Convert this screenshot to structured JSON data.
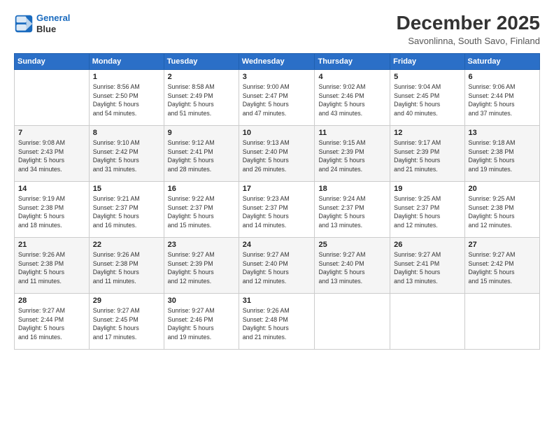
{
  "logo": {
    "line1": "General",
    "line2": "Blue"
  },
  "title": "December 2025",
  "subtitle": "Savonlinna, South Savo, Finland",
  "days_of_week": [
    "Sunday",
    "Monday",
    "Tuesday",
    "Wednesday",
    "Thursday",
    "Friday",
    "Saturday"
  ],
  "weeks": [
    [
      {
        "day": "",
        "info": ""
      },
      {
        "day": "1",
        "info": "Sunrise: 8:56 AM\nSunset: 2:50 PM\nDaylight: 5 hours\nand 54 minutes."
      },
      {
        "day": "2",
        "info": "Sunrise: 8:58 AM\nSunset: 2:49 PM\nDaylight: 5 hours\nand 51 minutes."
      },
      {
        "day": "3",
        "info": "Sunrise: 9:00 AM\nSunset: 2:47 PM\nDaylight: 5 hours\nand 47 minutes."
      },
      {
        "day": "4",
        "info": "Sunrise: 9:02 AM\nSunset: 2:46 PM\nDaylight: 5 hours\nand 43 minutes."
      },
      {
        "day": "5",
        "info": "Sunrise: 9:04 AM\nSunset: 2:45 PM\nDaylight: 5 hours\nand 40 minutes."
      },
      {
        "day": "6",
        "info": "Sunrise: 9:06 AM\nSunset: 2:44 PM\nDaylight: 5 hours\nand 37 minutes."
      }
    ],
    [
      {
        "day": "7",
        "info": "Sunrise: 9:08 AM\nSunset: 2:43 PM\nDaylight: 5 hours\nand 34 minutes."
      },
      {
        "day": "8",
        "info": "Sunrise: 9:10 AM\nSunset: 2:42 PM\nDaylight: 5 hours\nand 31 minutes."
      },
      {
        "day": "9",
        "info": "Sunrise: 9:12 AM\nSunset: 2:41 PM\nDaylight: 5 hours\nand 28 minutes."
      },
      {
        "day": "10",
        "info": "Sunrise: 9:13 AM\nSunset: 2:40 PM\nDaylight: 5 hours\nand 26 minutes."
      },
      {
        "day": "11",
        "info": "Sunrise: 9:15 AM\nSunset: 2:39 PM\nDaylight: 5 hours\nand 24 minutes."
      },
      {
        "day": "12",
        "info": "Sunrise: 9:17 AM\nSunset: 2:39 PM\nDaylight: 5 hours\nand 21 minutes."
      },
      {
        "day": "13",
        "info": "Sunrise: 9:18 AM\nSunset: 2:38 PM\nDaylight: 5 hours\nand 19 minutes."
      }
    ],
    [
      {
        "day": "14",
        "info": "Sunrise: 9:19 AM\nSunset: 2:38 PM\nDaylight: 5 hours\nand 18 minutes."
      },
      {
        "day": "15",
        "info": "Sunrise: 9:21 AM\nSunset: 2:37 PM\nDaylight: 5 hours\nand 16 minutes."
      },
      {
        "day": "16",
        "info": "Sunrise: 9:22 AM\nSunset: 2:37 PM\nDaylight: 5 hours\nand 15 minutes."
      },
      {
        "day": "17",
        "info": "Sunrise: 9:23 AM\nSunset: 2:37 PM\nDaylight: 5 hours\nand 14 minutes."
      },
      {
        "day": "18",
        "info": "Sunrise: 9:24 AM\nSunset: 2:37 PM\nDaylight: 5 hours\nand 13 minutes."
      },
      {
        "day": "19",
        "info": "Sunrise: 9:25 AM\nSunset: 2:37 PM\nDaylight: 5 hours\nand 12 minutes."
      },
      {
        "day": "20",
        "info": "Sunrise: 9:25 AM\nSunset: 2:38 PM\nDaylight: 5 hours\nand 12 minutes."
      }
    ],
    [
      {
        "day": "21",
        "info": "Sunrise: 9:26 AM\nSunset: 2:38 PM\nDaylight: 5 hours\nand 11 minutes."
      },
      {
        "day": "22",
        "info": "Sunrise: 9:26 AM\nSunset: 2:38 PM\nDaylight: 5 hours\nand 11 minutes."
      },
      {
        "day": "23",
        "info": "Sunrise: 9:27 AM\nSunset: 2:39 PM\nDaylight: 5 hours\nand 12 minutes."
      },
      {
        "day": "24",
        "info": "Sunrise: 9:27 AM\nSunset: 2:40 PM\nDaylight: 5 hours\nand 12 minutes."
      },
      {
        "day": "25",
        "info": "Sunrise: 9:27 AM\nSunset: 2:40 PM\nDaylight: 5 hours\nand 13 minutes."
      },
      {
        "day": "26",
        "info": "Sunrise: 9:27 AM\nSunset: 2:41 PM\nDaylight: 5 hours\nand 13 minutes."
      },
      {
        "day": "27",
        "info": "Sunrise: 9:27 AM\nSunset: 2:42 PM\nDaylight: 5 hours\nand 15 minutes."
      }
    ],
    [
      {
        "day": "28",
        "info": "Sunrise: 9:27 AM\nSunset: 2:44 PM\nDaylight: 5 hours\nand 16 minutes."
      },
      {
        "day": "29",
        "info": "Sunrise: 9:27 AM\nSunset: 2:45 PM\nDaylight: 5 hours\nand 17 minutes."
      },
      {
        "day": "30",
        "info": "Sunrise: 9:27 AM\nSunset: 2:46 PM\nDaylight: 5 hours\nand 19 minutes."
      },
      {
        "day": "31",
        "info": "Sunrise: 9:26 AM\nSunset: 2:48 PM\nDaylight: 5 hours\nand 21 minutes."
      },
      {
        "day": "",
        "info": ""
      },
      {
        "day": "",
        "info": ""
      },
      {
        "day": "",
        "info": ""
      }
    ]
  ]
}
